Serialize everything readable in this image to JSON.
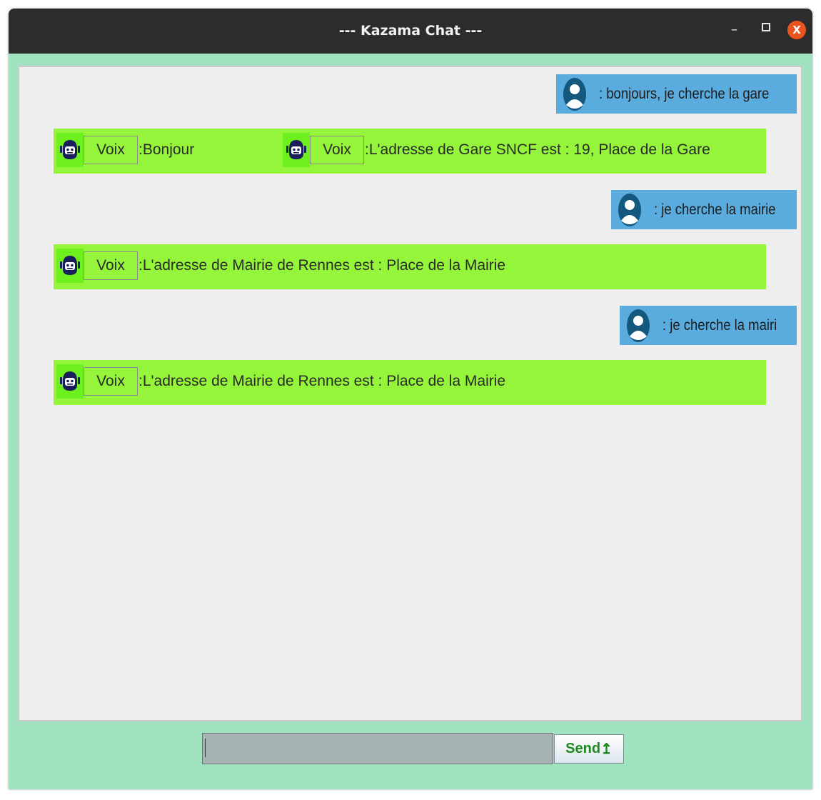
{
  "window": {
    "title": "--- Kazama Chat ---",
    "minimize_glyph": "–",
    "close_glyph": "X"
  },
  "messages": {
    "user1": {
      "text": ": bonjours, je cherche la gare"
    },
    "bot1a": {
      "voice_label": "Voix",
      "text": ":Bonjour"
    },
    "bot1b": {
      "voice_label": "Voix",
      "text": ":L'adresse de Gare SNCF est : 19, Place de la Gare"
    },
    "user2": {
      "text": ": je cherche la mairie"
    },
    "bot2": {
      "voice_label": "Voix",
      "text": ":L'adresse de Mairie de Rennes est : Place de la Mairie"
    },
    "user3": {
      "text": ": je cherche la mairi"
    },
    "bot3": {
      "voice_label": "Voix",
      "text": ":L'adresse de Mairie de Rennes est : Place de la Mairie"
    }
  },
  "input": {
    "value": ""
  },
  "send": {
    "label": "Send",
    "icon_glyph": "↥"
  },
  "colors": {
    "window_bg": "#a1e3c0",
    "titlebar": "#2d2c2c",
    "user_bubble": "#5aacde",
    "bot_bubble": "#95f53a",
    "avatar_bg": "#6ef01e",
    "close_button": "#e95420",
    "send_text": "#1e8a1e"
  },
  "icons": {
    "user_avatar": "user-avatar-icon",
    "bot_avatar": "robot-avatar-icon"
  }
}
